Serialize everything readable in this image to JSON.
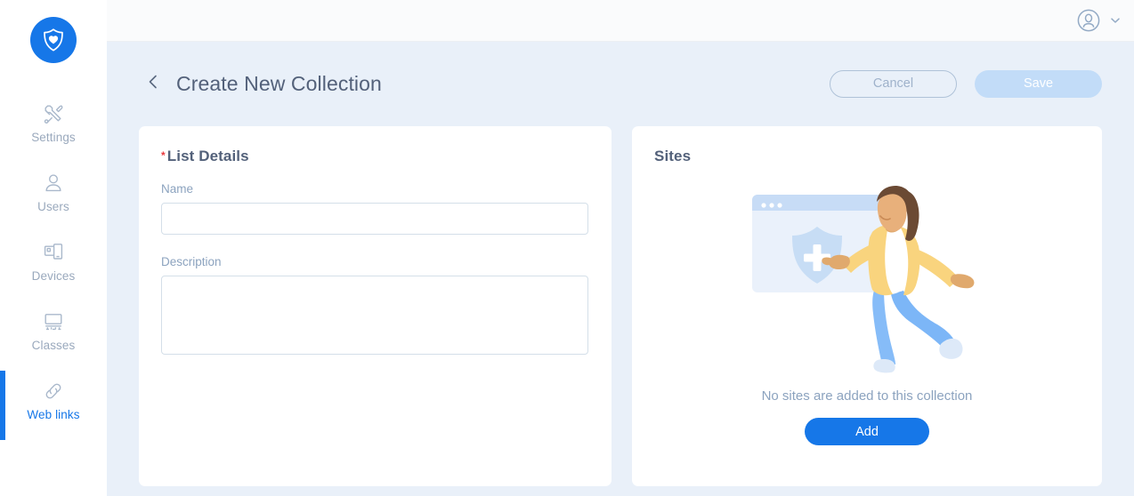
{
  "brand": {
    "logo_icon": "shield-heart-logo",
    "accent_color": "#1677e8"
  },
  "topbar": {
    "avatar_icon": "user-avatar-icon",
    "chevron_icon": "chevron-down-icon"
  },
  "sidebar": {
    "items": [
      {
        "label": "Settings",
        "icon": "tools-icon",
        "active": false
      },
      {
        "label": "Users",
        "icon": "user-icon",
        "active": false
      },
      {
        "label": "Devices",
        "icon": "devices-icon",
        "active": false
      },
      {
        "label": "Classes",
        "icon": "classroom-icon",
        "active": false
      },
      {
        "label": "Web links",
        "icon": "link-icon",
        "active": true
      }
    ]
  },
  "header": {
    "back_icon": "chevron-left-icon",
    "title": "Create New Collection",
    "cancel_label": "Cancel",
    "save_label": "Save"
  },
  "list_details": {
    "title": "List Details",
    "required_marker": "*",
    "name_label": "Name",
    "name_value": "",
    "name_placeholder": "",
    "description_label": "Description",
    "description_value": "",
    "description_placeholder": ""
  },
  "sites": {
    "title": "Sites",
    "illustration": "woman-adding-site-illustration",
    "empty_message": "No sites are added to this collection",
    "add_label": "Add"
  },
  "colors": {
    "accent": "#1677e8",
    "content_bg": "#e9f0f9",
    "panel_bg": "#ffffff",
    "muted_text": "#8ca3bf",
    "title_text": "#53617a",
    "required_red": "#e8393e",
    "save_disabled": "#c2dcf8"
  }
}
